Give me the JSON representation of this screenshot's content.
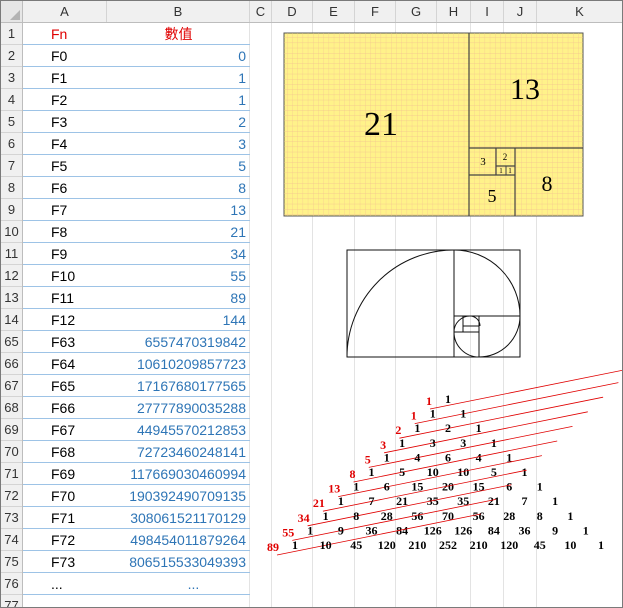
{
  "columns": [
    "A",
    "B",
    "C",
    "D",
    "E",
    "F",
    "G",
    "H",
    "I",
    "J",
    "K"
  ],
  "rows": [
    {
      "num": "1",
      "label": "Fn",
      "value": "數值",
      "header": true
    },
    {
      "num": "2",
      "label": "F0",
      "value": "0"
    },
    {
      "num": "3",
      "label": "F1",
      "value": "1"
    },
    {
      "num": "4",
      "label": "F2",
      "value": "1"
    },
    {
      "num": "5",
      "label": "F3",
      "value": "2"
    },
    {
      "num": "6",
      "label": "F4",
      "value": "3"
    },
    {
      "num": "7",
      "label": "F5",
      "value": "5"
    },
    {
      "num": "8",
      "label": "F6",
      "value": "8"
    },
    {
      "num": "9",
      "label": "F7",
      "value": "13"
    },
    {
      "num": "10",
      "label": "F8",
      "value": "21"
    },
    {
      "num": "11",
      "label": "F9",
      "value": "34"
    },
    {
      "num": "12",
      "label": "F10",
      "value": "55"
    },
    {
      "num": "13",
      "label": "F11",
      "value": "89"
    },
    {
      "num": "14",
      "label": "F12",
      "value": "144"
    },
    {
      "num": "65",
      "label": "F63",
      "value": "6557470319842"
    },
    {
      "num": "66",
      "label": "F64",
      "value": "10610209857723"
    },
    {
      "num": "67",
      "label": "F65",
      "value": "17167680177565"
    },
    {
      "num": "68",
      "label": "F66",
      "value": "27777890035288"
    },
    {
      "num": "69",
      "label": "F67",
      "value": "44945570212853"
    },
    {
      "num": "70",
      "label": "F68",
      "value": "72723460248141"
    },
    {
      "num": "71",
      "label": "F69",
      "value": "117669030460994"
    },
    {
      "num": "72",
      "label": "F70",
      "value": "190392490709135"
    },
    {
      "num": "73",
      "label": "F71",
      "value": "308061521170129"
    },
    {
      "num": "74",
      "label": "F72",
      "value": "498454011879264"
    },
    {
      "num": "75",
      "label": "F73",
      "value": "806515533049393"
    },
    {
      "num": "76",
      "label": "...",
      "value": "..."
    },
    {
      "num": "77",
      "label": "",
      "value": ""
    }
  ],
  "rect_labels": [
    "21",
    "13",
    "8",
    "5",
    "3",
    "2",
    "1",
    "1"
  ],
  "pascal": {
    "diag_labels": [
      "1",
      "1",
      "2",
      "3",
      "5",
      "8",
      "13",
      "21",
      "34",
      "55",
      "89"
    ],
    "rows": [
      "1",
      "1 1",
      "1 2 1",
      "1 3 3 1",
      "1 4 6 4 1",
      "1 5 10 10 5 1",
      "1 6 15 20 15 6 1",
      "1 7 21 35 35 21 7 1",
      "1 8 28 56 70 56 28 8 1",
      "1 9 36 84 126 126 84 36 9 1",
      "1 10 45 120 210 252 210 120 45 10 1"
    ]
  },
  "colors": {
    "grid_header_red": "#e00000",
    "value_blue": "#2e75b6",
    "yellow_fill": "#fff28a",
    "diag_red": "#e00000"
  }
}
